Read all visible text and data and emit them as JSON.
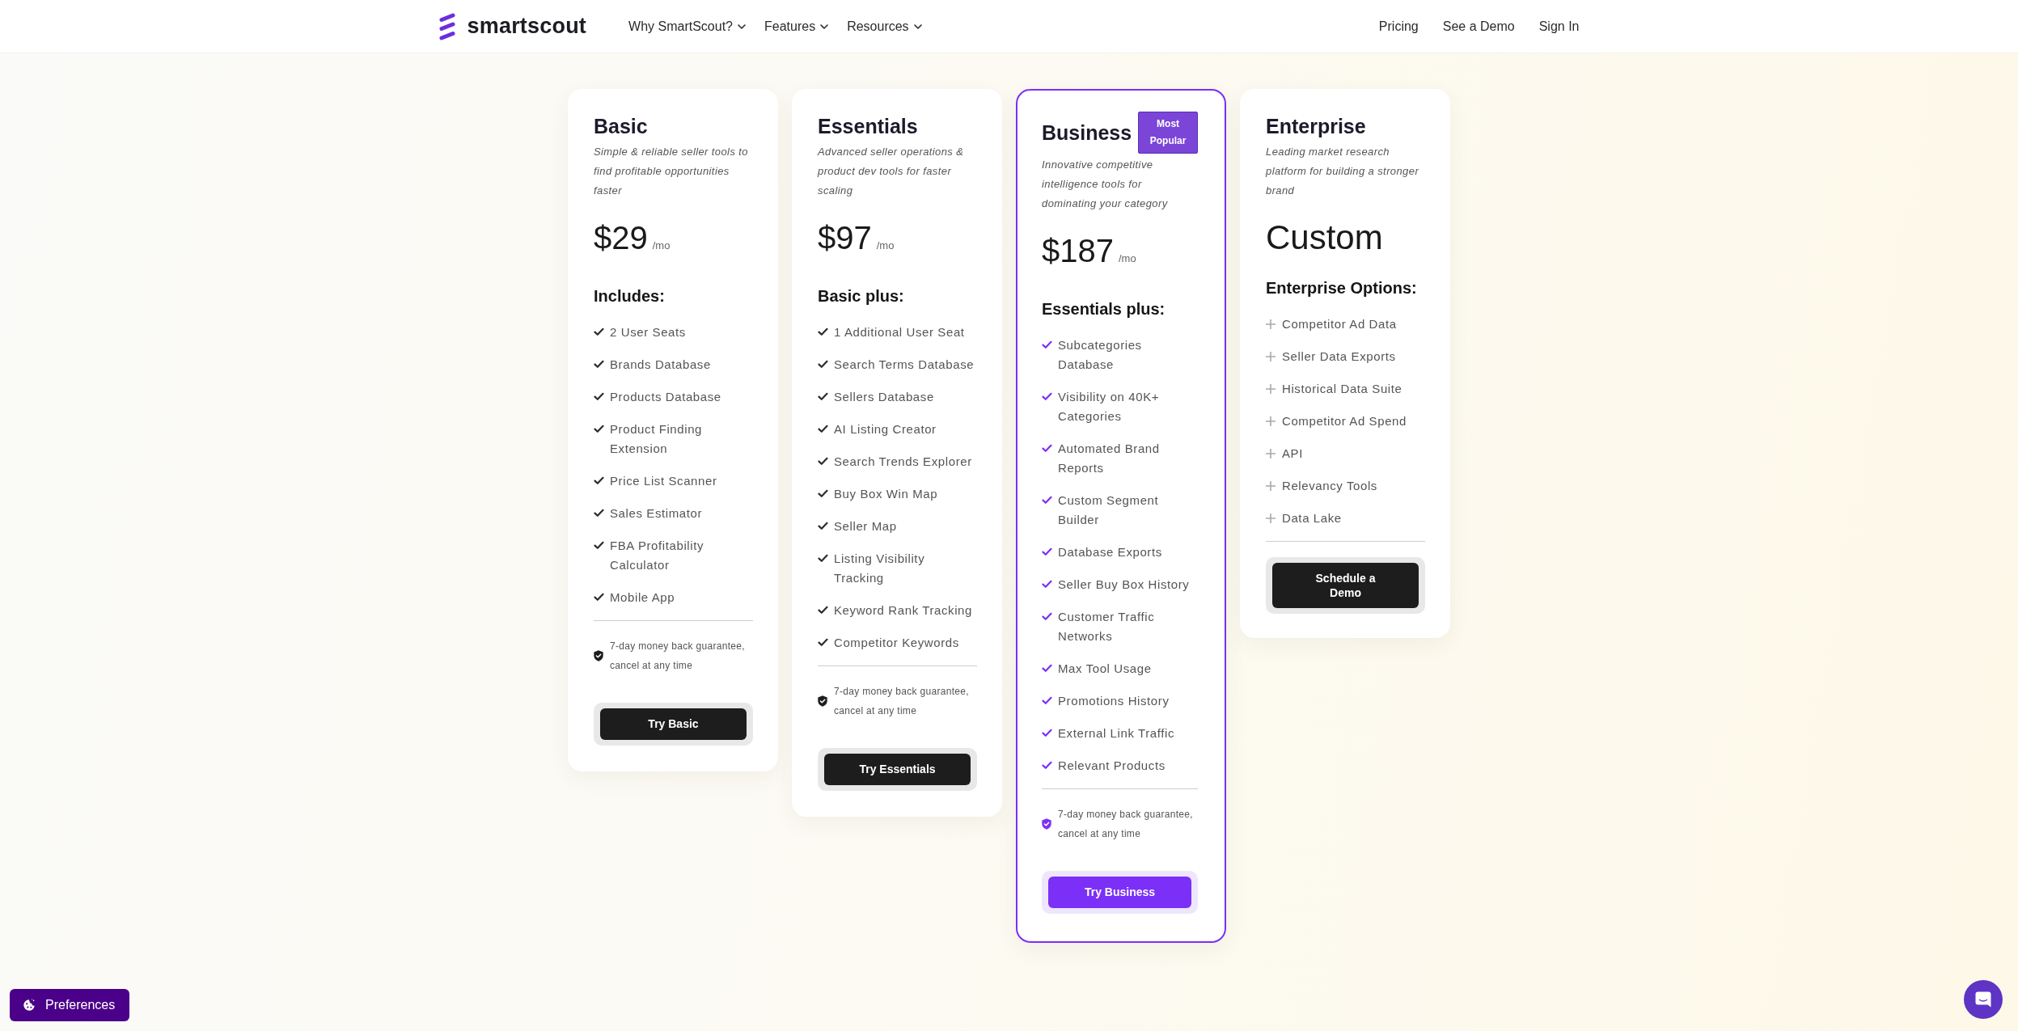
{
  "header": {
    "logo": "smartscout",
    "nav": [
      {
        "label": "Why SmartScout?",
        "dropdown": true
      },
      {
        "label": "Features",
        "dropdown": true
      },
      {
        "label": "Resources",
        "dropdown": true
      }
    ],
    "links": [
      {
        "label": "Pricing"
      },
      {
        "label": "See a Demo"
      },
      {
        "label": "Sign In"
      }
    ]
  },
  "plans": [
    {
      "kind": "plan",
      "name": "Basic",
      "highlighted": false,
      "description": "Simple & reliable seller tools to find profitable opportunities faster",
      "price": "$29",
      "period": "/mo",
      "features_heading": "Includes:",
      "features": [
        "2 User Seats",
        "Brands Database",
        "Products Database",
        "Product Finding Extension",
        "Price List Scanner",
        "Sales Estimator",
        "FBA Profitability Calculator",
        "Mobile App"
      ],
      "guarantee": "7-day money back guarantee, cancel at any time",
      "button": "Try Basic"
    },
    {
      "kind": "plan",
      "name": "Essentials",
      "highlighted": false,
      "description": "Advanced seller operations & product dev tools for faster scaling",
      "price": "$97",
      "period": "/mo",
      "features_heading": "Basic plus:",
      "features": [
        "1 Additional User Seat",
        "Search Terms Database",
        "Sellers Database",
        "AI Listing Creator",
        "Search Trends Explorer",
        "Buy Box Win Map",
        "Seller Map",
        "Listing Visibility Tracking",
        "Keyword Rank Tracking",
        "Competitor Keywords"
      ],
      "guarantee": "7-day money back guarantee, cancel at any time",
      "button": "Try Essentials"
    },
    {
      "kind": "plan",
      "name": "Business",
      "badge": "Most Popular",
      "highlighted": true,
      "description": "Innovative competitive intelligence tools for dominating your category",
      "price": "$187",
      "period": "/mo",
      "features_heading": "Essentials plus:",
      "features": [
        "Subcategories Database",
        "Visibility on 40K+ Categories",
        "Automated Brand Reports",
        "Custom Segment Builder",
        "Database Exports",
        "Seller Buy Box History",
        "Customer Traffic Networks",
        "Max Tool Usage",
        "Promotions History",
        "External Link Traffic",
        "Relevant Products"
      ],
      "guarantee": "7-day money back guarantee, cancel at any time",
      "button": "Try Business"
    },
    {
      "kind": "enterprise",
      "name": "Enterprise",
      "highlighted": false,
      "description": "Leading market research platform for building a stronger brand",
      "price": "Custom",
      "features_heading": "Enterprise Options:",
      "features": [
        "Competitor Ad Data",
        "Seller Data Exports",
        "Historical Data Suite",
        "Competitor Ad Spend",
        "API",
        "Relevancy Tools",
        "Data Lake"
      ],
      "button": "Schedule a Demo"
    }
  ],
  "cookie_button": {
    "label": "Preferences"
  }
}
